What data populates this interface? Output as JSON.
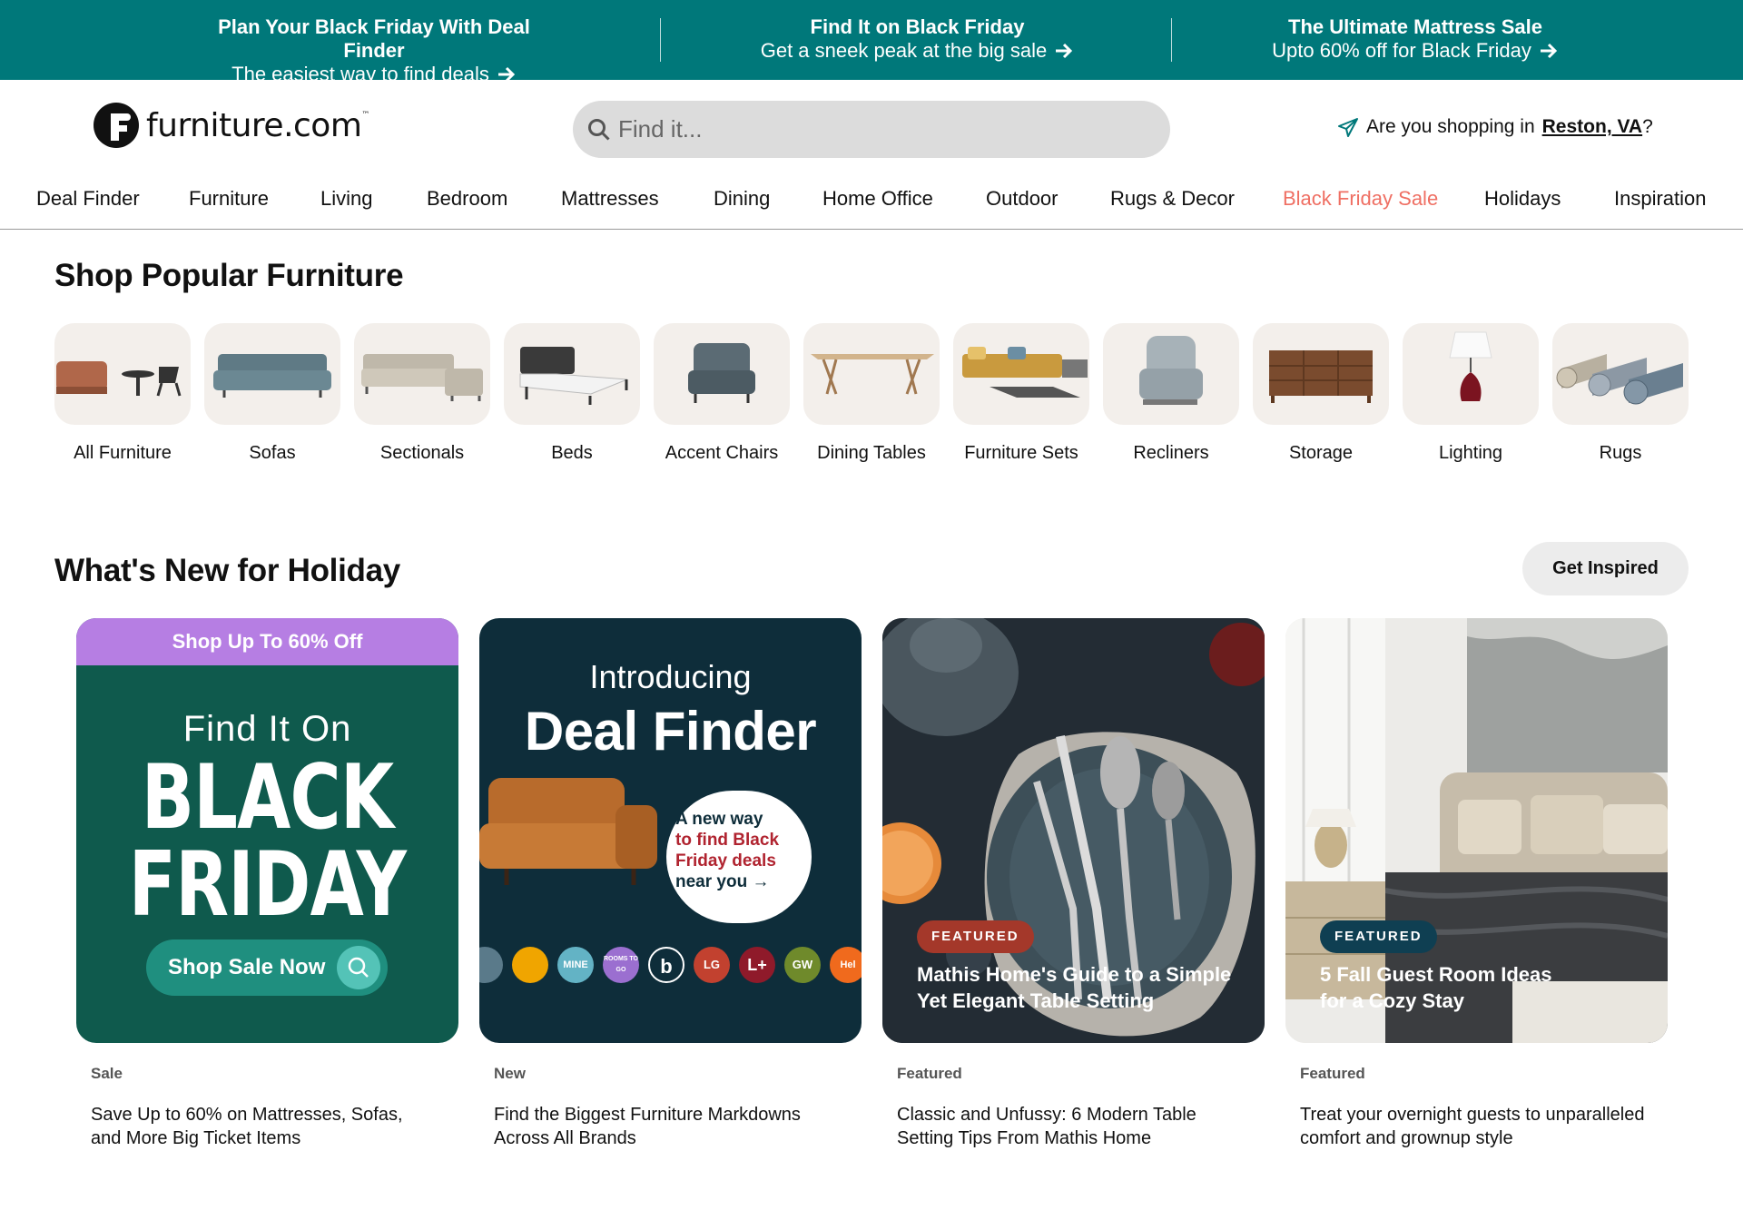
{
  "promo": [
    {
      "title": "Plan Your Black Friday With Deal Finder",
      "subtitle": "The easiest way to find deals"
    },
    {
      "title": "Find It on Black Friday",
      "subtitle": "Get a sneek peak at the big sale"
    },
    {
      "title": "The Ultimate Mattress Sale",
      "subtitle": "Upto 60% off for Black Friday"
    }
  ],
  "header": {
    "logo_text": "furniture.com",
    "logo_tm": "™",
    "search_placeholder": "Find it...",
    "location_prefix": "Are you shopping in",
    "location_city": "Reston, VA",
    "location_suffix": "?"
  },
  "nav": [
    {
      "label": "Deal Finder"
    },
    {
      "label": "Furniture"
    },
    {
      "label": "Living"
    },
    {
      "label": "Bedroom"
    },
    {
      "label": "Mattresses"
    },
    {
      "label": "Dining"
    },
    {
      "label": "Home Office"
    },
    {
      "label": "Outdoor"
    },
    {
      "label": "Rugs & Decor"
    },
    {
      "label": "Black Friday Sale",
      "accent": "#ef6f63"
    },
    {
      "label": "Holidays"
    },
    {
      "label": "Inspiration"
    }
  ],
  "popular": {
    "title": "Shop Popular Furniture",
    "categories": [
      {
        "label": "All Furniture"
      },
      {
        "label": "Sofas"
      },
      {
        "label": "Sectionals"
      },
      {
        "label": "Beds"
      },
      {
        "label": "Accent Chairs"
      },
      {
        "label": "Dining Tables"
      },
      {
        "label": "Furniture Sets"
      },
      {
        "label": "Recliners"
      },
      {
        "label": "Storage"
      },
      {
        "label": "Lighting"
      },
      {
        "label": "Rugs"
      }
    ]
  },
  "holiday": {
    "title": "What's New for Holiday",
    "button": "Get Inspired",
    "cards": [
      {
        "tag": "Sale",
        "title": "Save Up to 60% on Mattresses, Sofas, and More Big Ticket Items",
        "banner": "Shop Up To 60% Off",
        "line1": "Find It On",
        "line2": "BLACK",
        "line3": "FRIDAY",
        "cta": "Shop Sale Now"
      },
      {
        "tag": "New",
        "title": "Find the Biggest Furniture Markdowns Across All Brands",
        "intro": "Introducing",
        "headline": "Deal Finder",
        "bubble1": "A new way",
        "bubble2": "to find Black",
        "bubble3": "Friday deals",
        "bubble4": "near you →",
        "brands": [
          "MINE",
          "ROOMS TO GO",
          "b",
          "LG",
          "L+",
          "GW",
          "Hel"
        ]
      },
      {
        "tag": "Featured",
        "title": "Classic and Unfussy: 6 Modern Table Setting Tips From Mathis Home",
        "badge": "FEATURED",
        "caption": "Mathis Home's Guide to a Simple Yet Elegant Table Setting"
      },
      {
        "tag": "Featured",
        "title": "Treat your overnight guests to unparalleled comfort and grownup style",
        "badge": "FEATURED",
        "caption": "5 Fall Guest Room Ideas for a Cozy Stay"
      }
    ]
  },
  "colors": {
    "promo_bg": "#00787a",
    "sale_accent": "#ef6f63",
    "card1_bg": "#0f5a4d",
    "card1_banner": "#b67ee3",
    "card2_bg": "#0e2d3a",
    "badge_red": "#a4382a",
    "badge_navy": "#0f3f52"
  },
  "icons": {
    "promo_arrow": "arrow-right-icon",
    "search": "search-icon",
    "location": "paper-plane-icon"
  }
}
